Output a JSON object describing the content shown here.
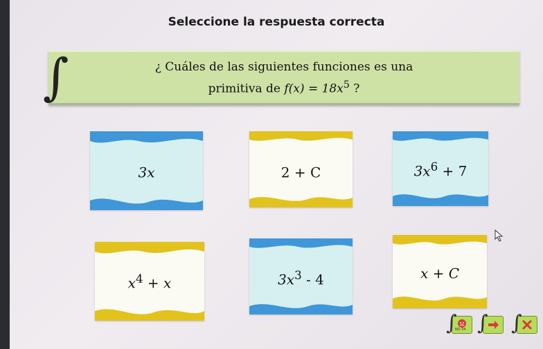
{
  "header": {
    "title": "Seleccione la respuesta correcta"
  },
  "question": {
    "line1": "¿ Cuáles de las siguientes funciones es una",
    "line2_prefix": "primitiva de ",
    "line2_formula": "f(x) = 18x",
    "line2_exp": "5",
    "line2_suffix": " ?"
  },
  "options": [
    {
      "base": "3x",
      "exp": "",
      "tail": "",
      "theme": "blue"
    },
    {
      "base": "2 + C",
      "exp": "",
      "tail": "",
      "theme": "yellow"
    },
    {
      "base": "3x",
      "exp": "6",
      "tail": " + 7",
      "theme": "blue"
    },
    {
      "base": "x",
      "exp": "4",
      "tail": " + x",
      "theme": "yellow"
    },
    {
      "base": "3x",
      "exp": "3",
      "tail": " - 4",
      "theme": "blue"
    },
    {
      "base": "x + C",
      "exp": "",
      "tail": "",
      "theme": "yellow"
    }
  ],
  "nav": {
    "help_badge": "NO 34",
    "colors": {
      "green": "#b6dc5c",
      "red": "#d93a3a"
    }
  },
  "colors": {
    "card_blue_fill": "#d6f0f1",
    "card_blue_wave": "#3f96d8",
    "card_yellow_fill": "#fbfbf4",
    "card_yellow_wave": "#e2c21c",
    "question_bg": "#cfe2a6"
  }
}
